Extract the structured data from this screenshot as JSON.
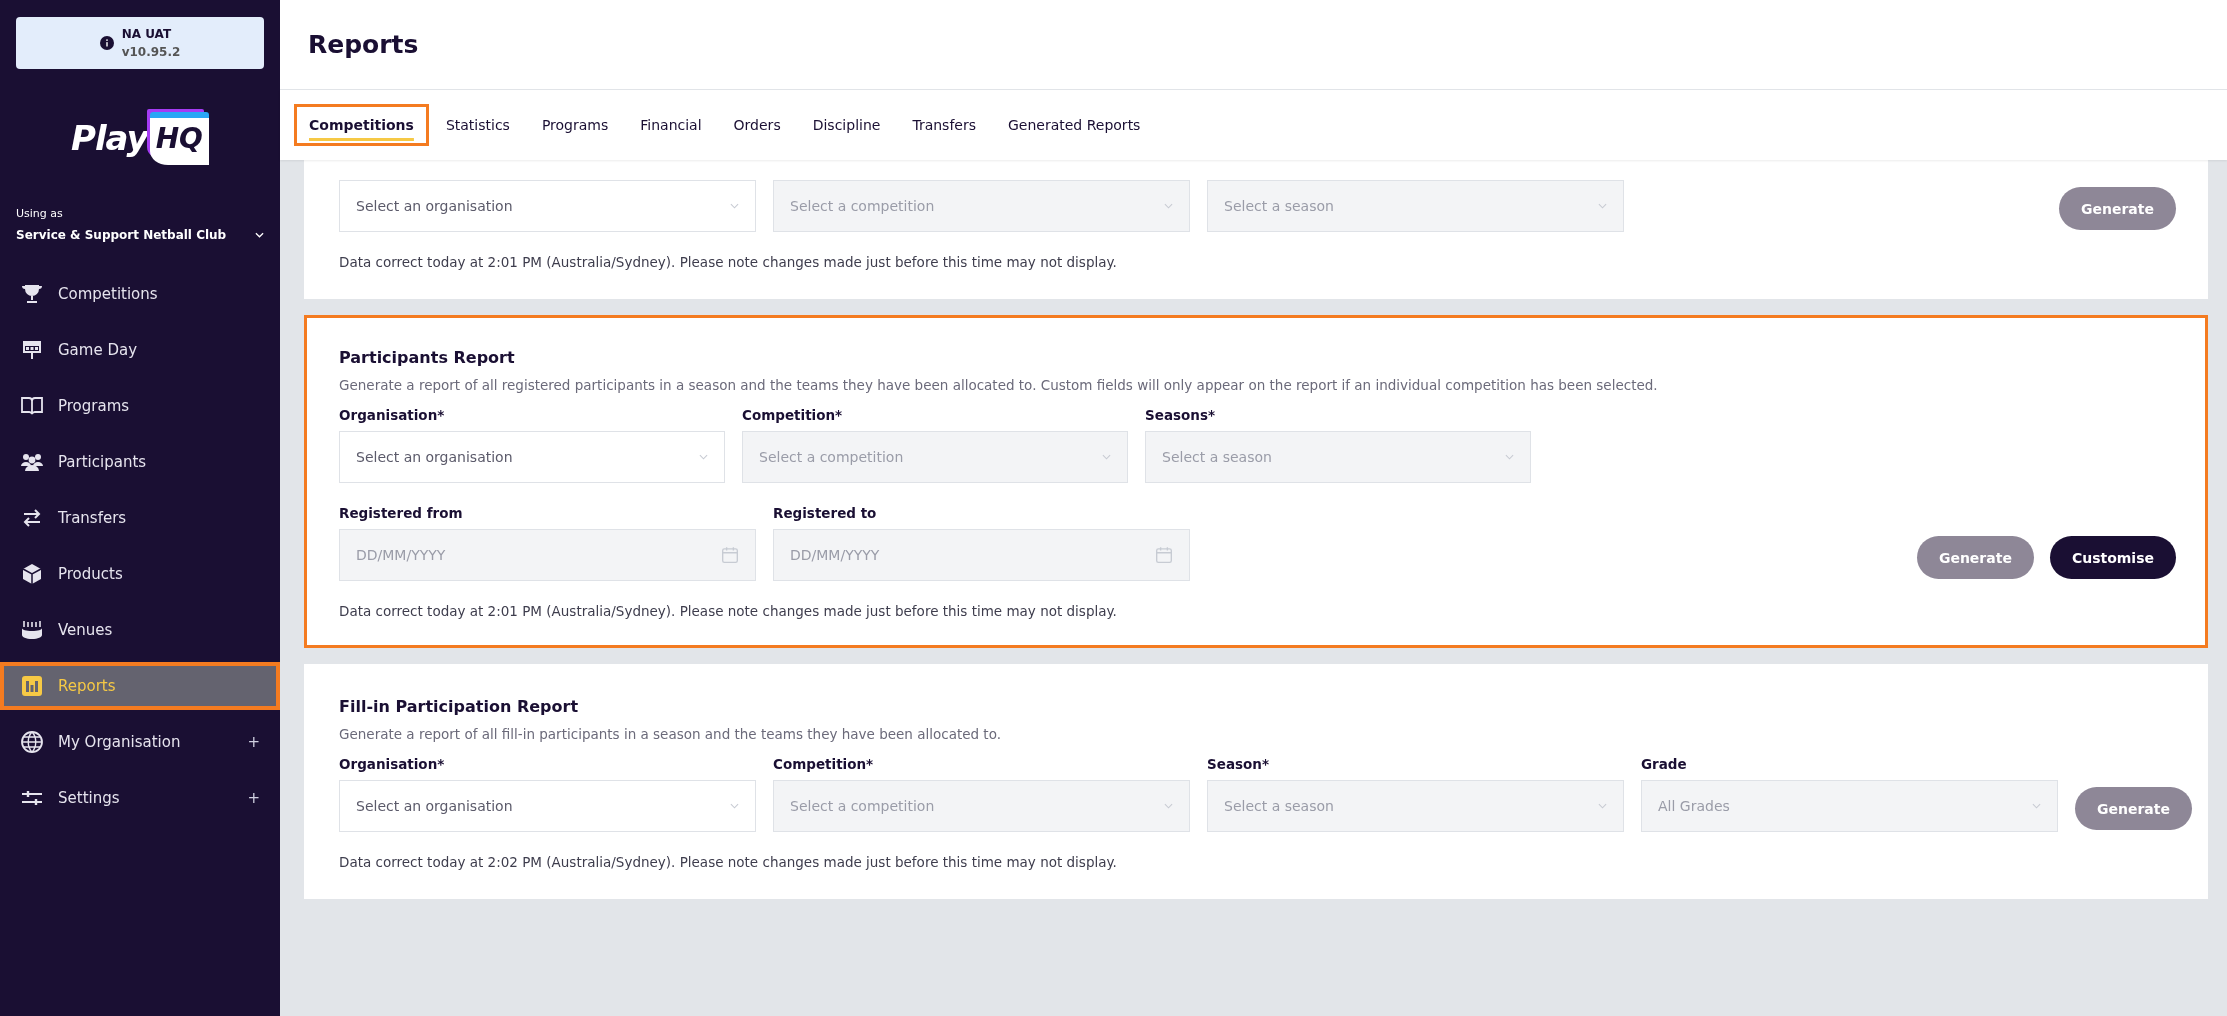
{
  "env_badge": {
    "name": "NA UAT",
    "version": "v10.95.2"
  },
  "logo": {
    "text": "Play",
    "badge": "HQ"
  },
  "org_switch": {
    "caption": "Using as",
    "name": "Service & Support Netball Club"
  },
  "nav": [
    {
      "label": "Competitions",
      "selected": false,
      "highlighted": false
    },
    {
      "label": "Game Day",
      "selected": false,
      "highlighted": false
    },
    {
      "label": "Programs",
      "selected": false,
      "highlighted": false
    },
    {
      "label": "Participants",
      "selected": false,
      "highlighted": false
    },
    {
      "label": "Transfers",
      "selected": false,
      "highlighted": false
    },
    {
      "label": "Products",
      "selected": false,
      "highlighted": false
    },
    {
      "label": "Venues",
      "selected": false,
      "highlighted": false
    },
    {
      "label": "Reports",
      "selected": true,
      "highlighted": true
    },
    {
      "label": "My Organisation",
      "selected": false,
      "highlighted": false,
      "suffix": "+"
    },
    {
      "label": "Settings",
      "selected": false,
      "highlighted": false,
      "suffix": "+"
    }
  ],
  "page_title": "Reports",
  "tabs": [
    {
      "label": "Competitions",
      "selected": true,
      "highlighted": true
    },
    {
      "label": "Statistics",
      "selected": false,
      "highlighted": false
    },
    {
      "label": "Programs",
      "selected": false,
      "highlighted": false
    },
    {
      "label": "Financial",
      "selected": false,
      "highlighted": false
    },
    {
      "label": "Orders",
      "selected": false,
      "highlighted": false
    },
    {
      "label": "Discipline",
      "selected": false,
      "highlighted": false
    },
    {
      "label": "Transfers",
      "selected": false,
      "highlighted": false
    },
    {
      "label": "Generated Reports",
      "selected": false,
      "highlighted": false
    }
  ],
  "cards": [
    {
      "highlighted": false,
      "rows": [
        {
          "fields": [
            {
              "kind": "select",
              "placeholder": "Select an organisation",
              "disabled": false
            },
            {
              "kind": "select",
              "placeholder": "Select a competition",
              "disabled": true
            },
            {
              "kind": "select",
              "placeholder": "Select a season",
              "disabled": true
            }
          ],
          "buttons": [
            {
              "label": "Generate",
              "disabled": true
            }
          ]
        }
      ],
      "note": "Data correct today at 2:01 PM (Australia/Sydney). Please note changes made just before this time may not display."
    },
    {
      "highlighted": true,
      "title": "Participants Report",
      "description": "Generate a report of all registered participants in a season and the teams they have been allocated to. Custom fields will only appear on the report if an individual competition has been selected.",
      "rows": [
        {
          "fields": [
            {
              "kind": "select",
              "label": "Organisation*",
              "placeholder": "Select an organisation",
              "disabled": false
            },
            {
              "kind": "select",
              "label": "Competition*",
              "placeholder": "Select a competition",
              "disabled": true
            },
            {
              "kind": "select",
              "label": "Seasons*",
              "placeholder": "Select a season",
              "disabled": true
            }
          ]
        },
        {
          "fields": [
            {
              "kind": "date",
              "label": "Registered from",
              "placeholder": "DD/MM/YYYY",
              "disabled": true
            },
            {
              "kind": "date",
              "label": "Registered to",
              "placeholder": "DD/MM/YYYY",
              "disabled": true
            }
          ],
          "buttons": [
            {
              "label": "Generate",
              "disabled": true
            },
            {
              "label": "Customise",
              "disabled": false
            }
          ]
        }
      ],
      "note": "Data correct today at 2:01 PM (Australia/Sydney). Please note changes made just before this time may not display."
    },
    {
      "highlighted": false,
      "title": "Fill-in Participation Report",
      "description": "Generate a report of all fill-in participants in a season and the teams they have been allocated to.",
      "rows": [
        {
          "fields": [
            {
              "kind": "select",
              "label": "Organisation*",
              "placeholder": "Select an organisation",
              "disabled": false
            },
            {
              "kind": "select",
              "label": "Competition*",
              "placeholder": "Select a competition",
              "disabled": true
            },
            {
              "kind": "select",
              "label": "Season*",
              "placeholder": "Select a season",
              "disabled": true
            },
            {
              "kind": "select",
              "label": "Grade",
              "placeholder": "All Grades",
              "disabled": true
            }
          ],
          "buttons": [
            {
              "label": "Generate",
              "disabled": true
            }
          ]
        }
      ],
      "note": "Data correct today at 2:02 PM (Australia/Sydney). Please note changes made just before this time may not display."
    }
  ]
}
